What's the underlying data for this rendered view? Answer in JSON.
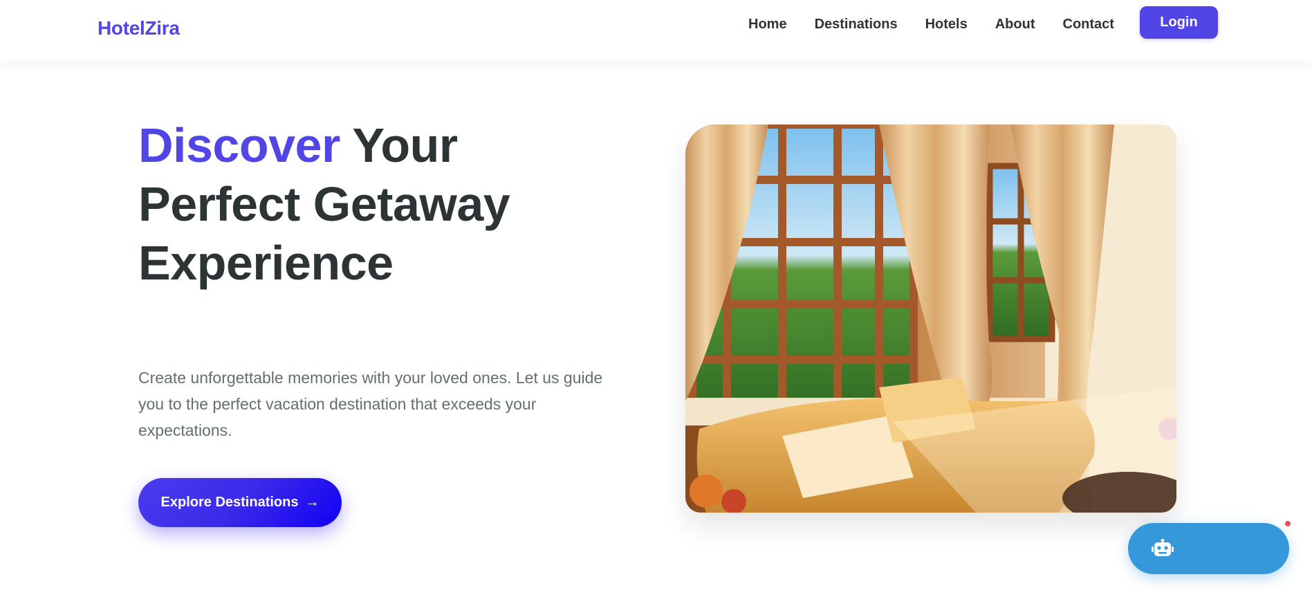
{
  "navbar": {
    "brand": "HotelZira",
    "links": [
      "Home",
      "Destinations",
      "Hotels",
      "About",
      "Contact"
    ],
    "login_label": "Login"
  },
  "hero": {
    "title_accent": "Discover",
    "title_rest": " Your Perfect Getaway Experience",
    "description": "Create unforgettable memories with your loved ones. Let us guide you to the perfect vacation destination that exceeds your expectations.",
    "cta_label": "Explore Destinations",
    "cta_arrow": "→",
    "image_subject": "sunlit hotel room with arched wooden windows, cream curtains and a golden sofa"
  },
  "chat_widget": {
    "icon": "robot-icon",
    "notification": true
  },
  "colors": {
    "brand": "#5145e5",
    "text_dark": "#2d3436",
    "text_muted": "#636e72",
    "chat": "#3498db",
    "notification": "#e74c5c"
  }
}
